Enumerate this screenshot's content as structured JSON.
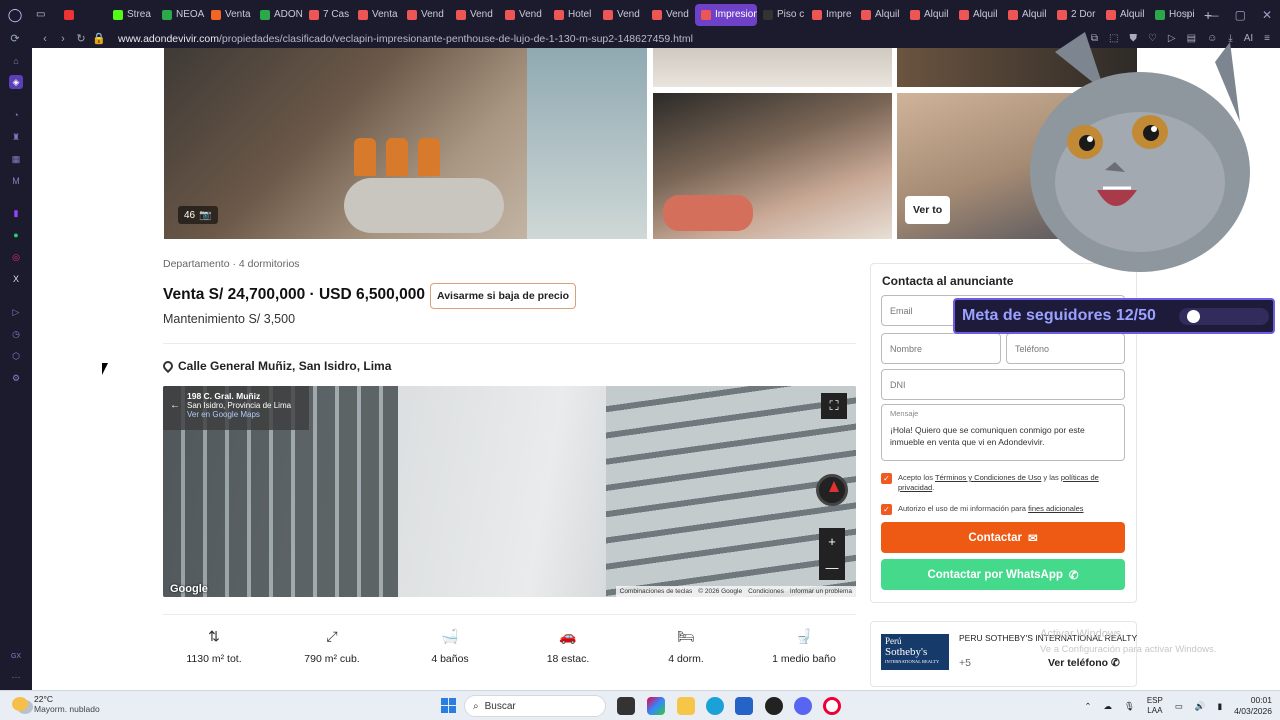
{
  "browser": {
    "tabs": [
      {
        "label": "",
        "color": "#e33"
      },
      {
        "label": "Strea",
        "color": "#53fc18"
      },
      {
        "label": "NEOA",
        "color": "#2aa84a"
      },
      {
        "label": "Venta",
        "color": "#f26522"
      },
      {
        "label": "ADON",
        "color": "#2aa84a"
      },
      {
        "label": "7 Cas",
        "color": "#e55"
      },
      {
        "label": "Venta",
        "color": "#e55"
      },
      {
        "label": "Vend",
        "color": "#e55"
      },
      {
        "label": "Vend",
        "color": "#e55"
      },
      {
        "label": "Vend",
        "color": "#e55"
      },
      {
        "label": "Hotel",
        "color": "#e55"
      },
      {
        "label": "Vend",
        "color": "#e55"
      },
      {
        "label": "Vend",
        "color": "#e55"
      },
      {
        "label": "Impresiona",
        "color": "#e55",
        "active": true
      },
      {
        "label": "Piso c",
        "color": "#333"
      },
      {
        "label": "Impre",
        "color": "#e55"
      },
      {
        "label": "Alquil",
        "color": "#e55"
      },
      {
        "label": "Alquil",
        "color": "#e55"
      },
      {
        "label": "Alquil",
        "color": "#e55"
      },
      {
        "label": "Alquil",
        "color": "#e55"
      },
      {
        "label": "2 Dor",
        "color": "#e55"
      },
      {
        "label": "Alquil",
        "color": "#e55"
      },
      {
        "label": "Hospi",
        "color": "#2aa84a"
      }
    ],
    "url_host": "www.adondevivir.com",
    "url_path": "/propiedades/clasificado/veclapin-impresionante-penthouse-de-lujo-de-1-130-m-sup2-148627459.html",
    "ai_label": "AI"
  },
  "listing": {
    "photo_count": "46",
    "see_all": "Ver to",
    "breadcrumb": "Departamento · 4 dormitorios",
    "price": "Venta S/ 24,700,000 · USD 6,500,000",
    "price_alert_button": "Avisarme si baja de precio",
    "maintenance": "Mantenimiento S/ 3,500",
    "address": "Calle General Muñiz, San Isidro, Lima",
    "map": {
      "street_title": "198 C. Gral. Muñiz",
      "street_sub": "San Isidro, Provincia de Lima",
      "street_link": "Ver en Google Maps",
      "google": "Google",
      "footer": [
        "Combinaciones de teclas",
        "© 2026 Google",
        "Condiciones",
        "Informar un problema"
      ],
      "zoom_in": "+",
      "zoom_out": "—"
    },
    "features": [
      {
        "icon": "⇅",
        "label": "1130 m² tot."
      },
      {
        "icon": "⤢",
        "label": "790 m² cub."
      },
      {
        "icon": "🛁",
        "label": "4 baños"
      },
      {
        "icon": "🚗",
        "label": "18 estac."
      },
      {
        "icon": "🛏",
        "label": "4 dorm."
      },
      {
        "icon": "🚽",
        "label": "1 medio baño"
      }
    ]
  },
  "contact": {
    "title": "Contacta al anunciante",
    "email_placeholder": "Email",
    "name_placeholder": "Nombre",
    "phone_placeholder": "Teléfono",
    "dni_placeholder": "DNI",
    "message_label": "Mensaje",
    "message_text": "¡Hola! Quiero que se comuniquen conmigo por este inmueble en venta que vi en Adondevivir.",
    "terms_pre": "Acepto los ",
    "terms_link": "Términos y Condiciones de Uso",
    "terms_mid": " y las ",
    "terms_link2": "políticas de privacidad",
    "terms_post": ".",
    "auth_pre": "Autorizo el uso de mi información para ",
    "auth_link": "fines adicionales",
    "contact_button": "Contactar",
    "whatsapp_button": "Contactar por WhatsApp"
  },
  "agency": {
    "logo_line1": "Perú",
    "logo_line2": "Sotheby's",
    "logo_line3": "INTERNATIONAL REALTY",
    "name": "PERU SOTHEBY'S INTERNATIONAL REALTY",
    "phone_prefix": "+5",
    "phone_button": "Ver teléfono"
  },
  "overlay": {
    "goal_text": "Meta de seguidores 12/50",
    "goal_progress": 0.24,
    "watermark_title": "Activar Windows",
    "watermark_sub": "Ve a Configuración para activar Windows."
  },
  "taskbar": {
    "temp": "22°C",
    "weather": "Mayorm. nublado",
    "search": "Buscar",
    "lang1": "ESP",
    "lang2": "LAA",
    "time": "00:01",
    "date": "4/03/2026"
  },
  "colors": {
    "accent_orange": "#ee5a14",
    "whatsapp_green": "#45d98c",
    "browser_dark": "#1c1b2e",
    "active_tab": "#6f41c9"
  }
}
